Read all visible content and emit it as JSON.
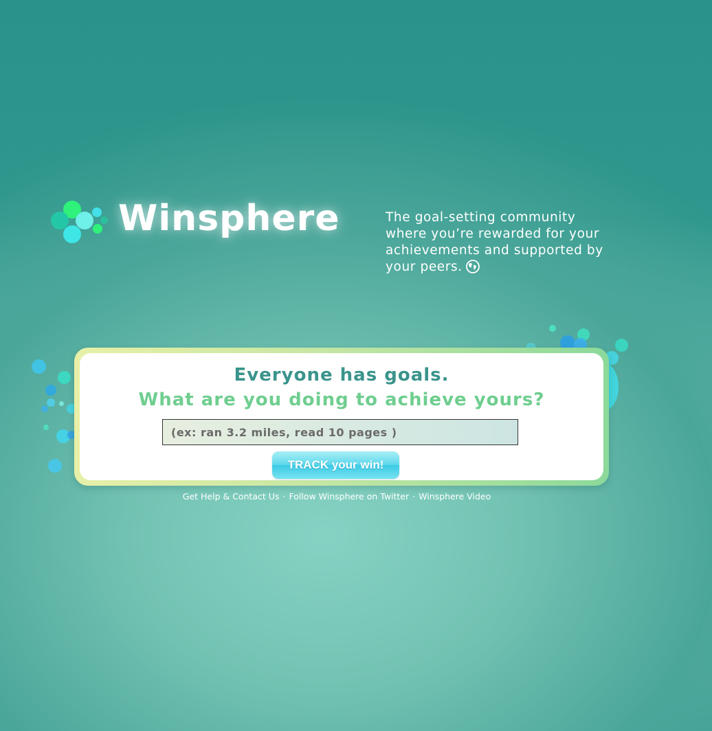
{
  "brand": {
    "name": "Winsphere",
    "colors": {
      "heading": "#3a948c",
      "subheading": "#6fce8f",
      "accent_button": "#5fd8ec"
    }
  },
  "tagline": "The goal-setting community where you’re rewarded for your achievements and supported by your peers.",
  "tagline_icon": "globe-icon",
  "card": {
    "headline": "Everyone has goals.",
    "subheadline": "What are you doing to achieve yours?",
    "input": {
      "placeholder": "(ex: ran 3.2 miles, read 10 pages )",
      "value": ""
    },
    "button_label": "TRACK your win!"
  },
  "footer": {
    "links": [
      {
        "label": "Get Help & Contact Us"
      },
      {
        "label": "Follow Winsphere on Twitter"
      },
      {
        "label": "Winsphere Video"
      }
    ],
    "separator": "·"
  }
}
